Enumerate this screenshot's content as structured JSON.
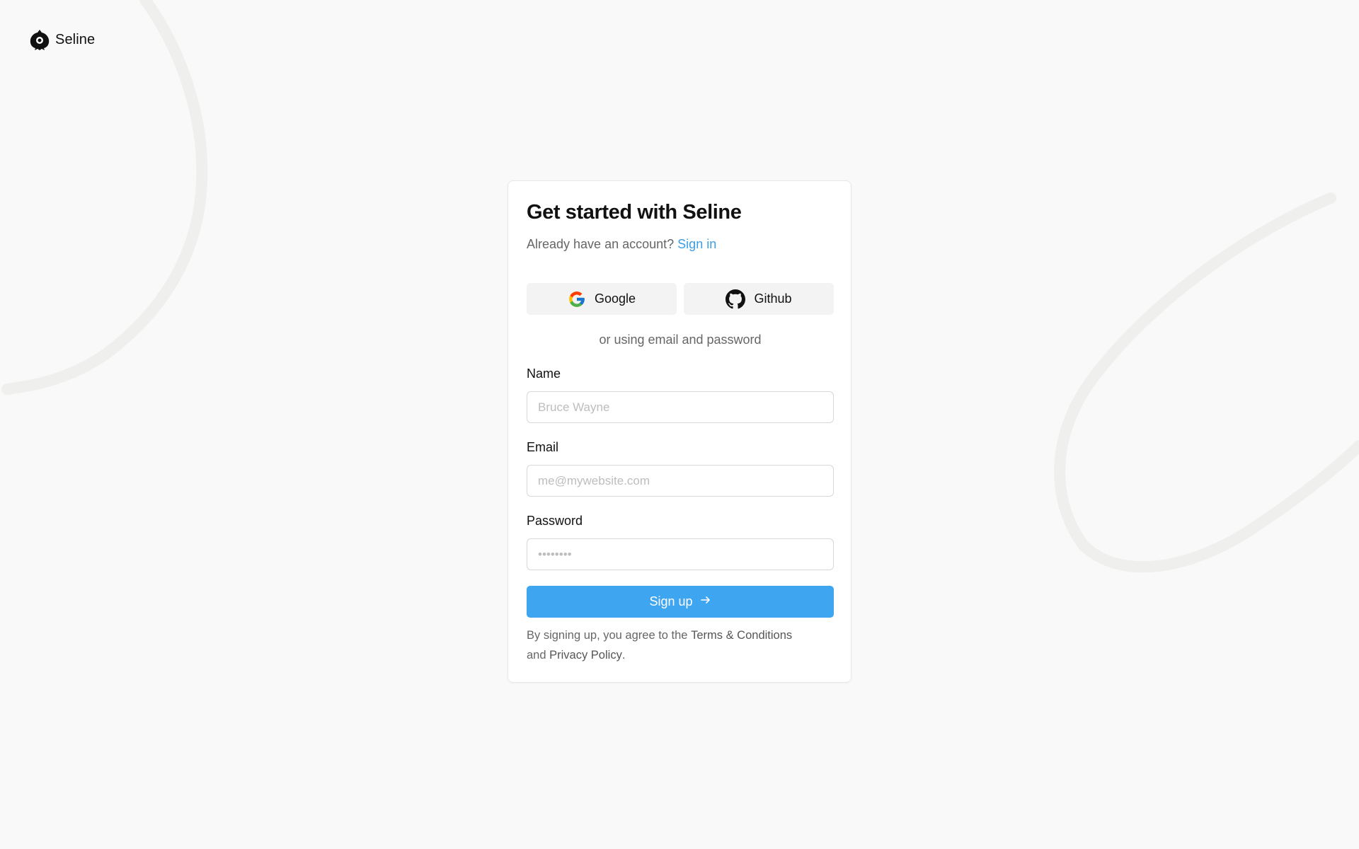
{
  "brand": {
    "name": "Seline",
    "logo_icon": "seline-logo-icon"
  },
  "card": {
    "title": "Get started with Seline",
    "subtitle_prefix": "Already have an account?",
    "signin_link": "Sign in",
    "oauth": {
      "google_label": "Google",
      "google_icon": "google-icon",
      "github_label": "Github",
      "github_icon": "github-icon"
    },
    "divider": "or using email and password",
    "fields": {
      "name_label": "Name",
      "name_placeholder": "Bruce Wayne",
      "email_label": "Email",
      "email_placeholder": "me@mywebsite.com",
      "password_label": "Password",
      "password_placeholder": "••••••••"
    },
    "submit_label": "Sign up",
    "submit_icon": "arrow-right-icon",
    "legal": {
      "prefix": "By signing up, you agree to the",
      "terms": "Terms & Conditions",
      "middle": "and",
      "privacy": "Privacy Policy",
      "suffix": "."
    }
  },
  "colors": {
    "accent": "#3ea5f0",
    "link": "#3a9ee6",
    "background": "#f9f9f9"
  }
}
